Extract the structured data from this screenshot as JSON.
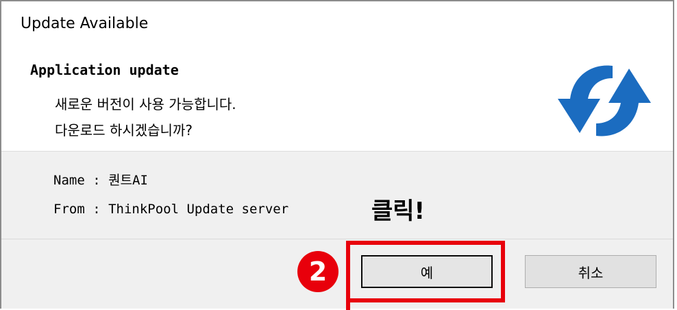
{
  "window": {
    "title": "Update Available"
  },
  "header": {
    "title": "Application update",
    "message_line1": "새로운 버전이 사용 가능합니다.",
    "message_line2": "다운로드 하시겠습니까?"
  },
  "info": {
    "name_line": "Name : 퀀트AI",
    "from_line": "From : ThinkPool Update server"
  },
  "annotation": {
    "click_text": "클릭!",
    "step_number": "2",
    "highlight_color": "#e8000b"
  },
  "buttons": {
    "ok_label": "예",
    "cancel_label": "취소"
  },
  "icons": {
    "update": "sync-arrows-icon",
    "update_color": "#1b6cc0"
  }
}
